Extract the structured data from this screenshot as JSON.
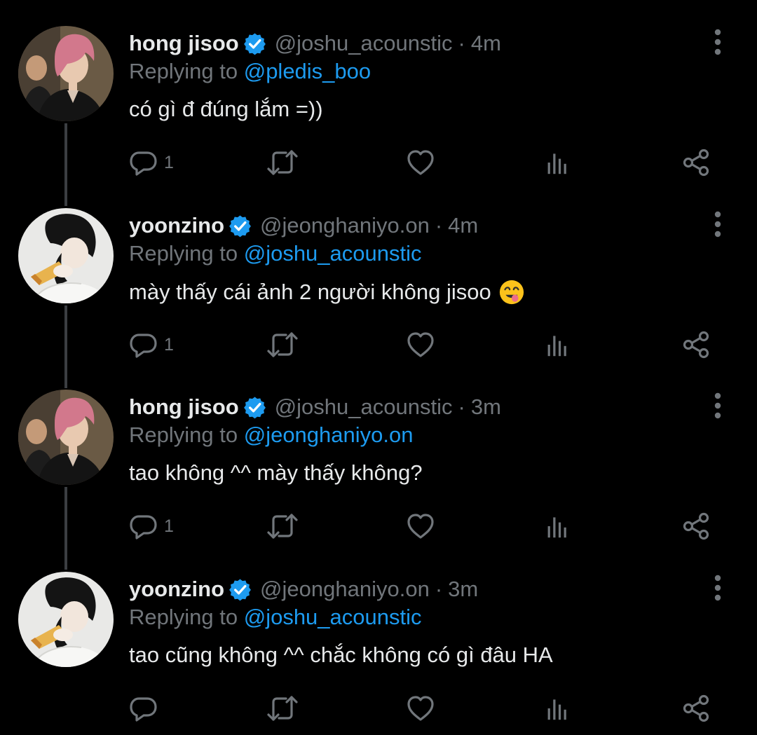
{
  "tweets": [
    {
      "name": "hong jisoo",
      "handle": "@joshu_acounstic",
      "separator": "·",
      "time": "4m",
      "replying_prefix": "Replying to",
      "replying_to": "@pledis_boo",
      "text": "có gì đ đúng lắm =))",
      "reply_count": "1",
      "avatar": "avatar-pink-hair"
    },
    {
      "name": "yoonzino",
      "handle": "@jeonghaniyo.on",
      "separator": "·",
      "time": "4m",
      "replying_prefix": "Replying to",
      "replying_to": "@joshu_acounstic",
      "text": "mày thấy cái ảnh 2 người không jisoo",
      "emoji": "face-savoring-food-emoji",
      "reply_count": "1",
      "avatar": "avatar-eating"
    },
    {
      "name": "hong jisoo",
      "handle": "@joshu_acounstic",
      "separator": "·",
      "time": "3m",
      "replying_prefix": "Replying to",
      "replying_to": "@jeonghaniyo.on",
      "text": "tao không ^^ mày thấy không?",
      "reply_count": "1",
      "avatar": "avatar-pink-hair"
    },
    {
      "name": "yoonzino",
      "handle": "@jeonghaniyo.on",
      "separator": "·",
      "time": "3m",
      "replying_prefix": "Replying to",
      "replying_to": "@joshu_acounstic",
      "text": "tao cũng không ^^ chắc không có gì đâu HA",
      "reply_count": "",
      "avatar": "avatar-eating"
    }
  ],
  "icons": [
    "reply-icon",
    "retweet-icon",
    "like-icon",
    "views-icon",
    "share-icon",
    "more-icon",
    "verified-badge-icon"
  ],
  "colors": {
    "background": "#000000",
    "text": "#e7e9ea",
    "secondary": "#71767b",
    "link": "#1d9bf0",
    "verified": "#1d9bf0",
    "thread_line": "#3b3e42"
  }
}
